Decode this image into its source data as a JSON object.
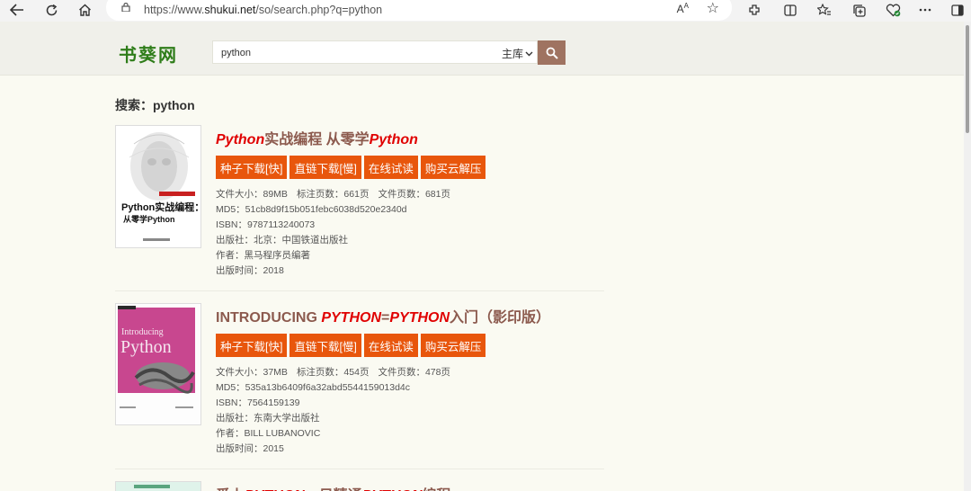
{
  "browser": {
    "url_prefix": "https://www.",
    "url_domain": "shukui.net",
    "url_path": "/so/search.php?q=python",
    "read_aloud": "Aᴬ"
  },
  "site": {
    "logo": "书葵网",
    "search_query": "python",
    "search_scope": "主库"
  },
  "page": {
    "heading": "搜索：python"
  },
  "buttons": {
    "torrent": "种子下载[快]",
    "direct": "直链下载[慢]",
    "online": "在线试读",
    "cloud": "购买云解压"
  },
  "books": [
    {
      "title_parts": [
        [
          "i",
          "Python"
        ],
        [
          "t",
          "实战编程 从零学"
        ],
        [
          "i",
          "Python"
        ]
      ],
      "size": "文件大小：89MB",
      "pages": "标注页数：661页",
      "file_pages": "文件页数：681页",
      "md5": "MD5：51cb8d9f15b051febc6038d520e2340d",
      "isbn": "ISBN：9787113240073",
      "publisher": "出版社：北京：中国铁道出版社",
      "author": "作者：黑马程序员编著",
      "year": "出版时间：2018",
      "cover_title": "Python实战编程：",
      "cover_sub": "从零学Python"
    },
    {
      "title_parts": [
        [
          "t",
          "INTRODUCING "
        ],
        [
          "i",
          "PYTHON"
        ],
        [
          "t",
          "="
        ],
        [
          "i",
          "PYTHON"
        ],
        [
          "t",
          "入门（影印版）"
        ]
      ],
      "size": "文件大小：37MB",
      "pages": "标注页数：454页",
      "file_pages": "文件页数：478页",
      "md5": "MD5：535a13b6409f6a32abd5544159013d4c",
      "isbn": "ISBN：7564159139",
      "publisher": "出版社：东南大学出版社",
      "author": "作者：BILL LUBANOVIC",
      "year": "出版时间：2015",
      "cover_title": "Introducing",
      "cover_sub": "Python"
    },
    {
      "title_parts": [
        [
          "t",
          "爱上"
        ],
        [
          "i",
          "PYTHON"
        ],
        [
          "t",
          "一日精通"
        ],
        [
          "i",
          "PYTHON"
        ],
        [
          "t",
          "编程"
        ]
      ]
    }
  ]
}
